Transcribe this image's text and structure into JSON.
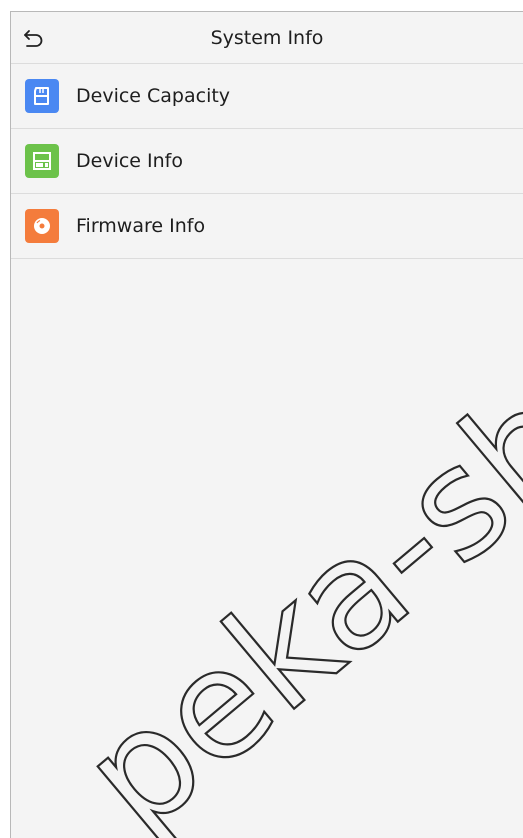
{
  "header": {
    "title": "System Info",
    "back_icon": "back-arrow-icon"
  },
  "menu": {
    "items": [
      {
        "label": "Device Capacity",
        "icon": "sd-card-icon",
        "color": "#4a88f2"
      },
      {
        "label": "Device Info",
        "icon": "device-icon",
        "color": "#6cc24a"
      },
      {
        "label": "Firmware Info",
        "icon": "disc-icon",
        "color": "#f47c3c"
      }
    ]
  },
  "watermark": {
    "text": "peka-sh"
  },
  "colors": {
    "background": "#f4f4f4",
    "divider": "#dcdcdc",
    "text": "#1e1e1e"
  }
}
